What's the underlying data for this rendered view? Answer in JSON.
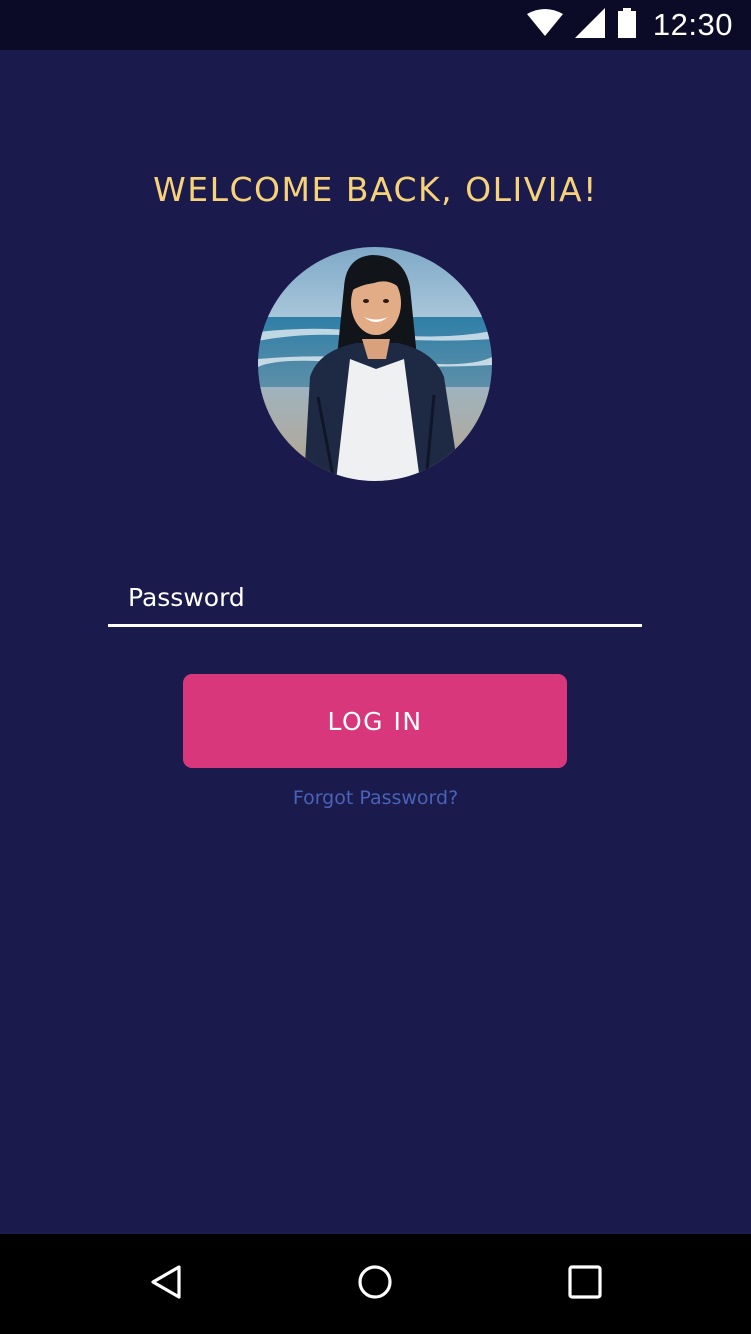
{
  "status_bar": {
    "time": "12:30",
    "icons": [
      "wifi-icon",
      "cell-signal-icon",
      "battery-icon"
    ]
  },
  "login": {
    "welcome_text": "WELCOME BACK, OLIVIA!",
    "password_placeholder": "Password",
    "login_button_label": "LOG IN",
    "forgot_password_label": "Forgot Password?"
  },
  "nav_bar": {
    "buttons": [
      "back-icon",
      "home-icon",
      "recents-icon"
    ]
  },
  "colors": {
    "background": "#1b1a4c",
    "status_bar": "#0b0b28",
    "welcome_text": "#f6d27a",
    "login_button": "#d9377b",
    "forgot_link": "#4a62b7",
    "nav_bar": "#000000"
  }
}
